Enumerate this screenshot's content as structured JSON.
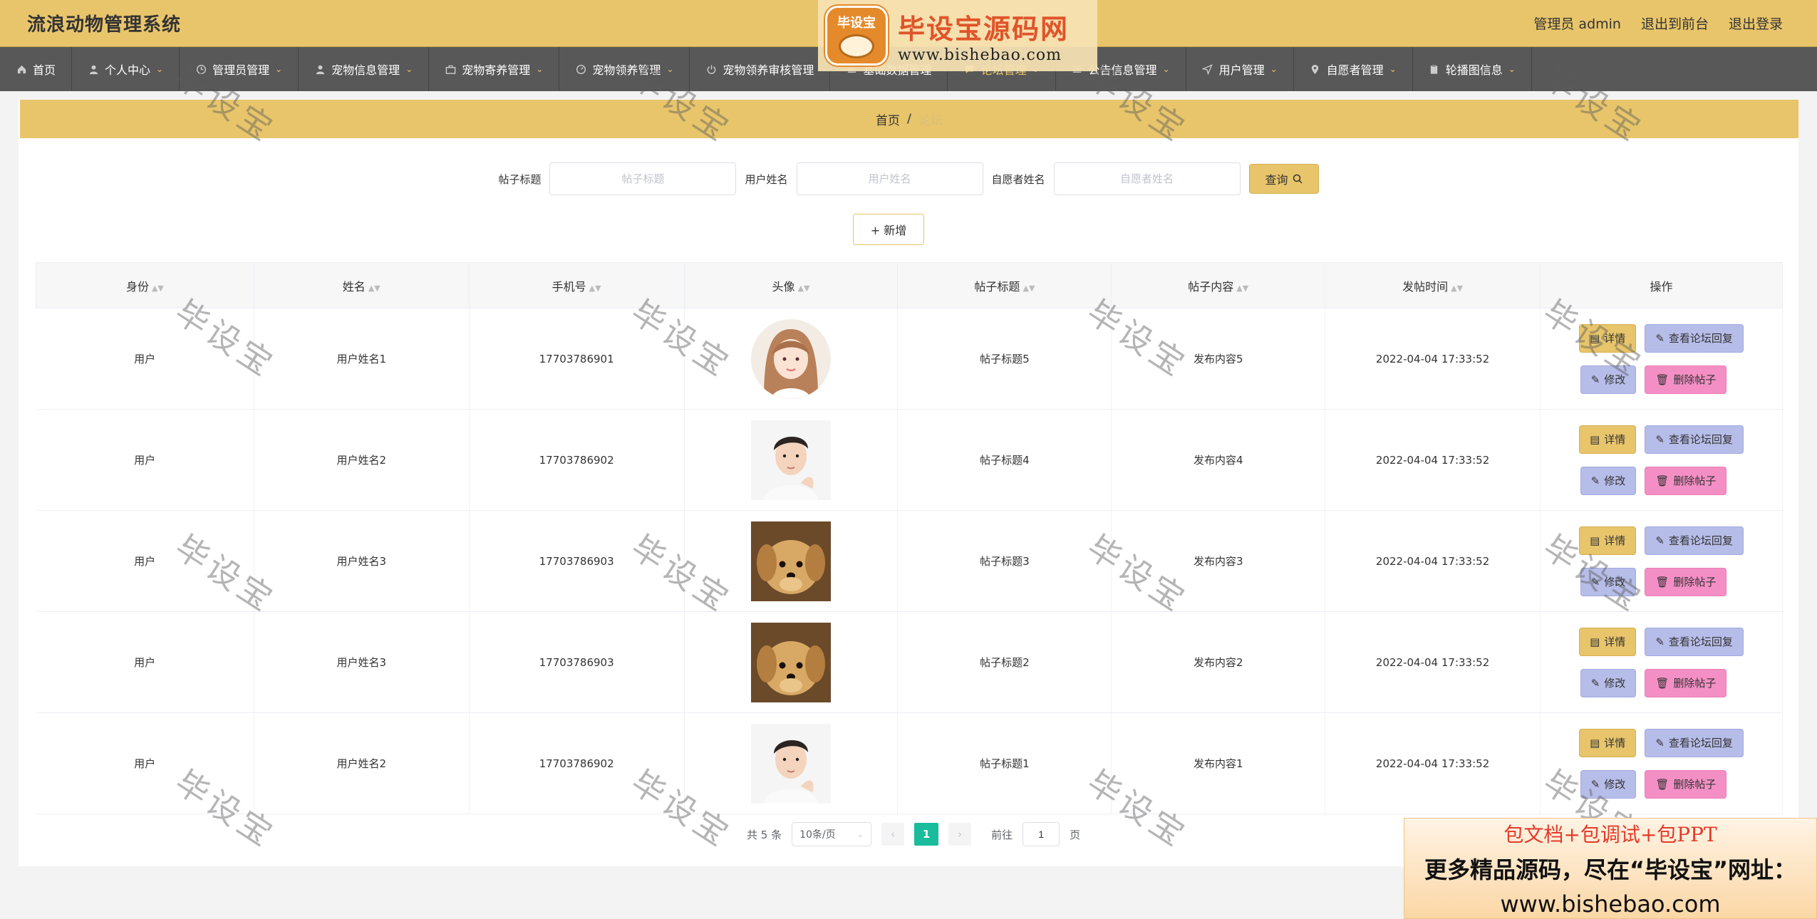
{
  "header": {
    "app_title": "流浪动物管理系统",
    "user_label": "管理员 admin",
    "to_front": "退出到前台",
    "logout": "退出登录"
  },
  "brand": {
    "badge": "毕设宝",
    "name": "毕设宝源码网",
    "url": "www.bishebao.com"
  },
  "nav": [
    {
      "label": "首页",
      "icon": "home-icon",
      "caret": false
    },
    {
      "label": "个人中心",
      "icon": "user-icon",
      "caret": true
    },
    {
      "label": "管理员管理",
      "icon": "clock-icon",
      "caret": true
    },
    {
      "label": "宠物信息管理",
      "icon": "user-icon",
      "caret": true
    },
    {
      "label": "宠物寄养管理",
      "icon": "briefcase-icon",
      "caret": true
    },
    {
      "label": "宠物领养管理",
      "icon": "gauge-icon",
      "caret": true
    },
    {
      "label": "宠物领养审核管理",
      "icon": "power-icon",
      "caret": false
    },
    {
      "label": "基础数据管理",
      "icon": "list-icon",
      "caret": false
    },
    {
      "label": "论坛管理",
      "icon": "chat-icon",
      "caret": true,
      "active": true
    },
    {
      "label": "公告信息管理",
      "icon": "list-icon",
      "caret": true
    },
    {
      "label": "用户管理",
      "icon": "send-icon",
      "caret": true
    },
    {
      "label": "自愿者管理",
      "icon": "location-icon",
      "caret": true
    },
    {
      "label": "轮播图信息",
      "icon": "clipboard-icon",
      "caret": true
    }
  ],
  "breadcrumb": {
    "home": "首页",
    "sep": "/",
    "current": "论坛"
  },
  "search": {
    "title_label": "帖子标题",
    "title_placeholder": "帖子标题",
    "user_label": "用户姓名",
    "user_placeholder": "用户姓名",
    "volunteer_label": "自愿者姓名",
    "volunteer_placeholder": "自愿者姓名",
    "query_label": "查询"
  },
  "add_label": "+ 新增",
  "table": {
    "columns": [
      "身份",
      "姓名",
      "手机号",
      "头像",
      "帖子标题",
      "帖子内容",
      "发帖时间",
      "操作"
    ],
    "rows": [
      {
        "role": "用户",
        "name": "用户姓名1",
        "phone": "17703786901",
        "avatar": "woman-avatar",
        "title": "帖子标题5",
        "content": "发布内容5",
        "time": "2022-04-04 17:33:52"
      },
      {
        "role": "用户",
        "name": "用户姓名2",
        "phone": "17703786902",
        "avatar": "man-avatar",
        "title": "帖子标题4",
        "content": "发布内容4",
        "time": "2022-04-04 17:33:52"
      },
      {
        "role": "用户",
        "name": "用户姓名3",
        "phone": "17703786903",
        "avatar": "puppy-avatar",
        "title": "帖子标题3",
        "content": "发布内容3",
        "time": "2022-04-04 17:33:52"
      },
      {
        "role": "用户",
        "name": "用户姓名3",
        "phone": "17703786903",
        "avatar": "puppy-avatar",
        "title": "帖子标题2",
        "content": "发布内容2",
        "time": "2022-04-04 17:33:52"
      },
      {
        "role": "用户",
        "name": "用户姓名2",
        "phone": "17703786902",
        "avatar": "man-avatar",
        "title": "帖子标题1",
        "content": "发布内容1",
        "time": "2022-04-04 17:33:52"
      }
    ],
    "actions": {
      "detail": "详情",
      "reply": "查看论坛回复",
      "edit": "修改",
      "delete": "删除帖子"
    }
  },
  "pagination": {
    "total": "共 5 条",
    "page_size": "10条/页",
    "current_page": "1",
    "goto_prefix": "前往",
    "goto_value": "1",
    "goto_suffix": "页"
  },
  "ad": {
    "line1": "包文档+包调试+包PPT",
    "line2": "更多精品源码，尽在“毕设宝”网址：",
    "line3": "www.bishebao.com"
  },
  "watermark": "毕设宝",
  "colors": {
    "accent": "#e8c56b",
    "nav_bg": "#585858",
    "reply_btn": "#b7bde9",
    "delete_btn": "#f48fc5",
    "page_active": "#1abc9c"
  }
}
